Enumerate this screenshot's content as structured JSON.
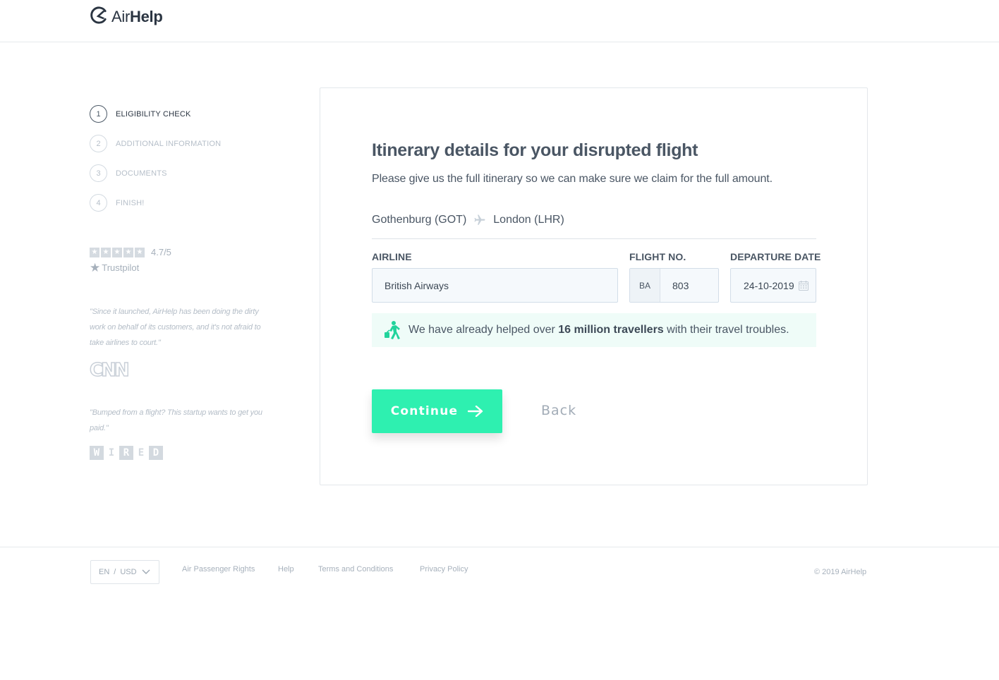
{
  "header": {
    "logo_air": "Air",
    "logo_help": "Help"
  },
  "steps": [
    {
      "number": "1",
      "label": "ELIGIBILITY CHECK",
      "active": true
    },
    {
      "number": "2",
      "label": "ADDITIONAL INFORMATION",
      "active": false
    },
    {
      "number": "3",
      "label": "DOCUMENTS",
      "active": false
    },
    {
      "number": "4",
      "label": "FINISH!",
      "active": false
    }
  ],
  "rating": {
    "value": "4.7/5",
    "stars": 5,
    "provider": "Trustpilot"
  },
  "quotes": [
    {
      "text": "\"Since it launched, AirHelp has been doing the dirty work on behalf of its customers, and it's not afraid to take airlines to court.\"",
      "source": "CNN"
    },
    {
      "text": "\"Bumped from a flight? This startup wants to get you paid.\"",
      "source": "WIRED"
    }
  ],
  "main": {
    "title": "Itinerary details for your disrupted flight",
    "subtitle": "Please give us the full itinerary so we can make sure we claim for the full amount.",
    "route": {
      "from": "Gothenburg (GOT)",
      "to": "London (LHR)"
    },
    "labels": {
      "airline": "AIRLINE",
      "flight_no": "FLIGHT NO.",
      "departure_date": "DEPARTURE DATE"
    },
    "airline_value": "British Airways",
    "flight_prefix": "BA",
    "flight_number": "803",
    "departure_date_value": "24-10-2019",
    "info": {
      "prefix": "We have already helped over ",
      "highlight": "16 million travellers",
      "suffix": " with their travel troubles."
    },
    "continue_label": "Continue",
    "back_label": "Back"
  },
  "footer": {
    "locale_lang": "EN",
    "locale_sep": "/",
    "locale_currency": "USD",
    "links": [
      "Air Passenger Rights",
      "Help",
      "Terms and Conditions",
      "Privacy Policy"
    ],
    "copyright": "© 2019 AirHelp"
  },
  "colors": {
    "accent": "#2ef0b0",
    "text": "#4a5664",
    "muted": "#b6bfc9",
    "info_bg": "#effcf8"
  },
  "icons": [
    "airhelp-logo-icon",
    "plane-icon",
    "calendar-icon",
    "traveller-icon",
    "arrow-right-icon",
    "chevron-down-icon",
    "star-icon"
  ]
}
